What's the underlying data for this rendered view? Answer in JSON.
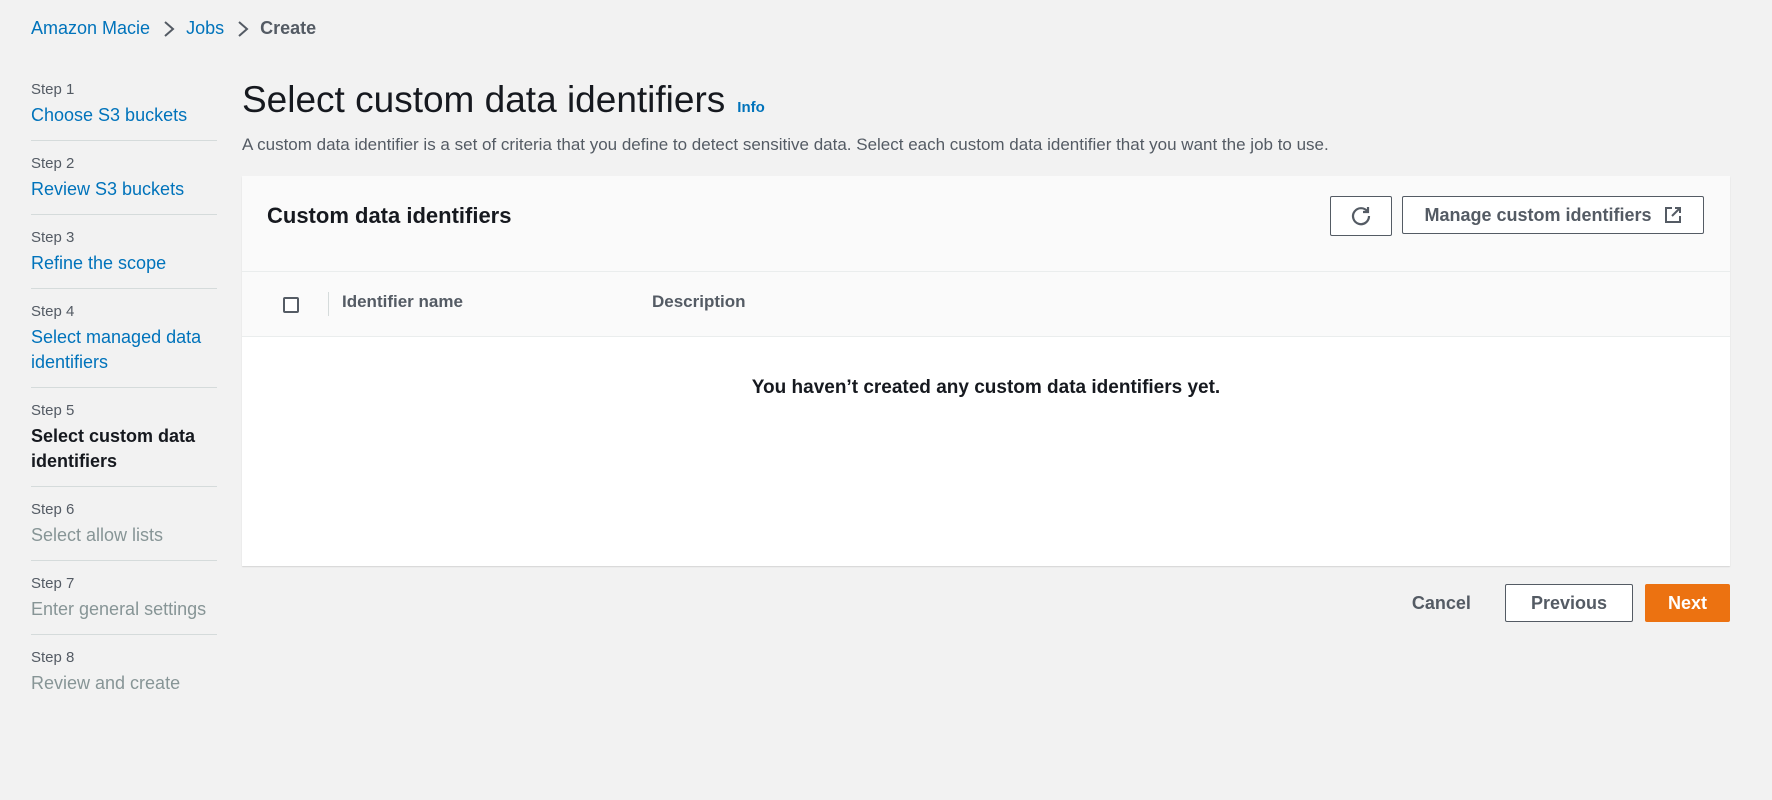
{
  "breadcrumb": [
    {
      "label": "Amazon Macie"
    },
    {
      "label": "Jobs"
    },
    {
      "label": "Create"
    }
  ],
  "steps": [
    {
      "num": "Step 1",
      "title": "Choose S3 buckets",
      "state": "done"
    },
    {
      "num": "Step 2",
      "title": "Review S3 buckets",
      "state": "done"
    },
    {
      "num": "Step 3",
      "title": "Refine the scope",
      "state": "done"
    },
    {
      "num": "Step 4",
      "title": "Select managed data identifiers",
      "state": "done"
    },
    {
      "num": "Step 5",
      "title": "Select custom data identifiers",
      "state": "current"
    },
    {
      "num": "Step 6",
      "title": "Select allow lists",
      "state": "disabled"
    },
    {
      "num": "Step 7",
      "title": "Enter general settings",
      "state": "disabled"
    },
    {
      "num": "Step 8",
      "title": "Review and create",
      "state": "disabled"
    }
  ],
  "page": {
    "title": "Select custom data identifiers",
    "info": "Info",
    "description": "A custom data identifier is a set of criteria that you define to detect sensitive data. Select each custom data identifier that you want the job to use."
  },
  "panel": {
    "title": "Custom data identifiers",
    "refresh_icon": "refresh-icon",
    "manage_label": "Manage custom identifiers",
    "manage_icon": "external-link-icon"
  },
  "table": {
    "columns": [
      "Identifier name",
      "Description"
    ],
    "empty_message": "You haven’t created any custom data identifiers yet."
  },
  "actions": {
    "cancel": "Cancel",
    "previous": "Previous",
    "next": "Next"
  },
  "colors": {
    "link": "#0073bb",
    "primary": "#ec7211",
    "background": "#f2f2f2"
  }
}
